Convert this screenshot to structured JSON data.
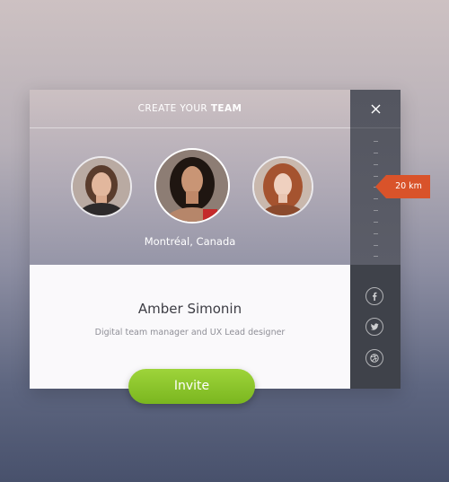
{
  "header": {
    "title_light": "CREATE YOUR ",
    "title_bold": "TEAM"
  },
  "team": {
    "location": "Montréal, Canada",
    "members": [
      {
        "position": "left"
      },
      {
        "position": "center",
        "selected": true
      },
      {
        "position": "right"
      }
    ]
  },
  "profile": {
    "name": "Amber Simonin",
    "role": "Digital team manager and UX Lead designer"
  },
  "distance": {
    "label": "20 km"
  },
  "social": [
    {
      "icon": "facebook-icon"
    },
    {
      "icon": "twitter-icon"
    },
    {
      "icon": "dribbble-icon"
    }
  ],
  "actions": {
    "invite_label": "Invite"
  },
  "colors": {
    "accent_green": "#8cc63f",
    "distance_tag": "#d9532a",
    "sidebar": "#53565f"
  }
}
